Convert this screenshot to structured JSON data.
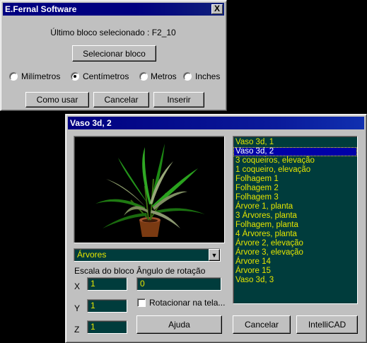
{
  "top_dialog": {
    "title": "E.Fernal Software",
    "close_glyph": "X",
    "last_block_label": "Último bloco selecionado : F2_10",
    "select_block_button": "Selecionar bloco",
    "units": [
      {
        "label": "Milímetros",
        "selected": false
      },
      {
        "label": "Centímetros",
        "selected": true
      },
      {
        "label": "Metros",
        "selected": false
      },
      {
        "label": "Inches",
        "selected": false
      }
    ],
    "buttons": {
      "how_to_use": "Como usar",
      "cancel": "Cancelar",
      "insert": "Inserir"
    }
  },
  "block_dialog": {
    "title": "Vaso 3d, 2",
    "preview_icon": "plant-in-pot-preview",
    "category_combo": {
      "value": "Árvores",
      "arrow": "chevron-down-icon"
    },
    "scale_label": "Escala do bloco",
    "scale": {
      "x_label": "X",
      "x_value": "1",
      "y_label": "Y",
      "y_value": "1",
      "z_label": "Z",
      "z_value": "1"
    },
    "rotation_label": "Ângulo de rotação",
    "rotation_value": "0",
    "rotate_on_screen_label": "Rotacionar na tela...",
    "rotate_on_screen_checked": false,
    "block_list": [
      {
        "label": "Vaso 3d, 1",
        "selected": false
      },
      {
        "label": "Vaso 3d, 2",
        "selected": true
      },
      {
        "label": "3 coqueiros, elevação",
        "selected": false
      },
      {
        "label": "1 coqueiro, elevação",
        "selected": false
      },
      {
        "label": "Folhagem 1",
        "selected": false
      },
      {
        "label": "Folhagem 2",
        "selected": false
      },
      {
        "label": "Folhagem 3",
        "selected": false
      },
      {
        "label": "Árvore 1, planta",
        "selected": false
      },
      {
        "label": "3 Árvores, planta",
        "selected": false
      },
      {
        "label": "Folhagem, planta",
        "selected": false
      },
      {
        "label": "4 Árvores, planta",
        "selected": false
      },
      {
        "label": "Árvore 2, elevação",
        "selected": false
      },
      {
        "label": "Árvore 3, elevação",
        "selected": false
      },
      {
        "label": "Árvore 14",
        "selected": false
      },
      {
        "label": "Árvore 15",
        "selected": false
      },
      {
        "label": "Vaso 3d, 3",
        "selected": false
      }
    ],
    "buttons": {
      "help": "Ajuda",
      "cancel": "Cancelar",
      "intellicad": "IntelliCAD"
    }
  },
  "colors": {
    "title_active": "#000080",
    "dialog_face": "#c0c0c0",
    "dark_field": "#003c3c",
    "dark_field_text": "#e6e600",
    "list_selection": "#0000a8"
  }
}
